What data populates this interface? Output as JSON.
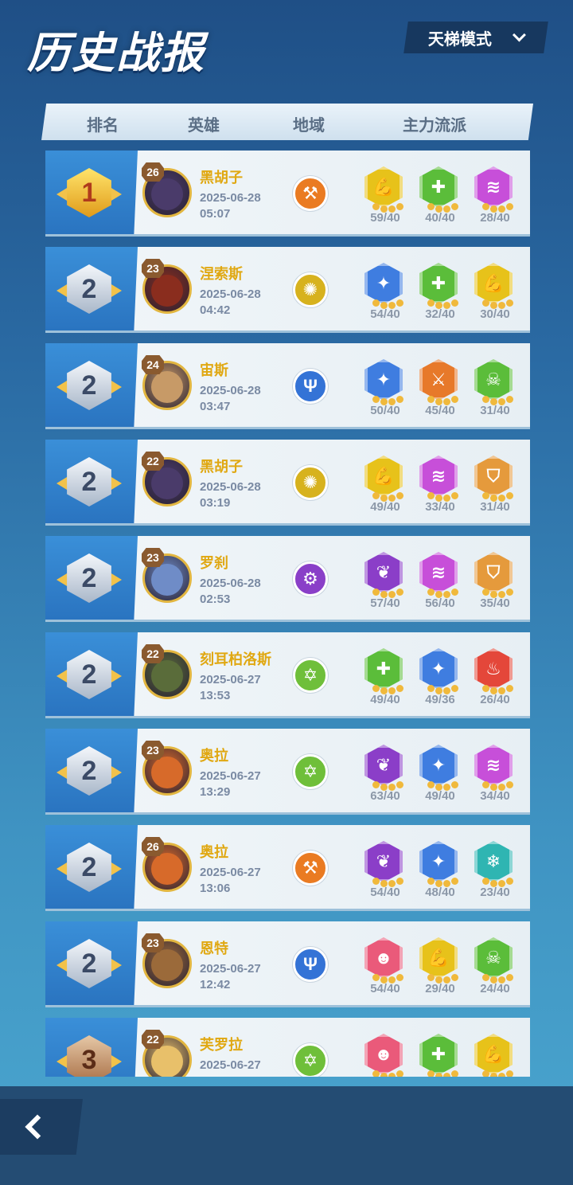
{
  "page_title": "历史战报",
  "mode_selector": {
    "label": "天梯模式"
  },
  "columns": {
    "rank": "排名",
    "hero": "英雄",
    "region": "地域",
    "build": "主力流派"
  },
  "colors": {
    "trait_yellow": "#e7c21a",
    "trait_green": "#5bbd3a",
    "trait_purple": "#c74fd9",
    "trait_blue": "#3f7de0",
    "trait_orange": "#e7792a",
    "trait_teal": "#2fb5b2",
    "trait_pink": "#ea5a7a",
    "trait_red": "#e4473a",
    "trait_violet": "#8b3ec8",
    "shield_orange": "#e59a3c"
  },
  "rows": [
    {
      "rank": "1",
      "level": "26",
      "hero": "黑胡子",
      "date": "2025-06-28",
      "time": "05:07",
      "region_icon": "axe-icon",
      "traits": [
        {
          "icon": "muscle-icon",
          "value": "59/40"
        },
        {
          "icon": "plus-icon",
          "value": "40/40"
        },
        {
          "icon": "claw-icon",
          "value": "28/40"
        }
      ]
    },
    {
      "rank": "2",
      "level": "23",
      "hero": "涅索斯",
      "date": "2025-06-28",
      "time": "04:42",
      "region_icon": "swirl-icon",
      "traits": [
        {
          "icon": "sparkle-icon",
          "value": "54/40"
        },
        {
          "icon": "plus-icon",
          "value": "32/40"
        },
        {
          "icon": "muscle-icon",
          "value": "30/40"
        }
      ]
    },
    {
      "rank": "2",
      "level": "24",
      "hero": "宙斯",
      "date": "2025-06-28",
      "time": "03:47",
      "region_icon": "trident-icon",
      "traits": [
        {
          "icon": "sparkle-icon",
          "value": "50/40"
        },
        {
          "icon": "sword-icon",
          "value": "45/40"
        },
        {
          "icon": "poison-icon",
          "value": "31/40"
        }
      ]
    },
    {
      "rank": "2",
      "level": "22",
      "hero": "黑胡子",
      "date": "2025-06-28",
      "time": "03:19",
      "region_icon": "swirl-icon",
      "traits": [
        {
          "icon": "muscle-icon",
          "value": "49/40"
        },
        {
          "icon": "claw-icon",
          "value": "33/40"
        },
        {
          "icon": "shield-icon",
          "value": "31/40"
        }
      ]
    },
    {
      "rank": "2",
      "level": "23",
      "hero": "罗刹",
      "date": "2025-06-28",
      "time": "02:53",
      "region_icon": "gear-icon",
      "traits": [
        {
          "icon": "leaf-icon",
          "value": "57/40"
        },
        {
          "icon": "claw-icon",
          "value": "56/40"
        },
        {
          "icon": "shield-icon",
          "value": "35/40"
        }
      ]
    },
    {
      "rank": "2",
      "level": "22",
      "hero": "刻耳柏洛斯",
      "date": "2025-06-27",
      "time": "13:53",
      "region_icon": "pentagram-icon",
      "traits": [
        {
          "icon": "plus-icon",
          "value": "49/40"
        },
        {
          "icon": "sparkle-icon",
          "value": "49/36"
        },
        {
          "icon": "flame-icon",
          "value": "26/40"
        }
      ]
    },
    {
      "rank": "2",
      "level": "23",
      "hero": "奥拉",
      "date": "2025-06-27",
      "time": "13:29",
      "region_icon": "pentagram-icon",
      "traits": [
        {
          "icon": "leaf-icon",
          "value": "63/40"
        },
        {
          "icon": "sparkle-icon",
          "value": "49/40"
        },
        {
          "icon": "claw-icon",
          "value": "34/40"
        }
      ]
    },
    {
      "rank": "2",
      "level": "26",
      "hero": "奥拉",
      "date": "2025-06-27",
      "time": "13:06",
      "region_icon": "axe-icon",
      "traits": [
        {
          "icon": "leaf-icon",
          "value": "54/40"
        },
        {
          "icon": "sparkle-icon",
          "value": "48/40"
        },
        {
          "icon": "snowflake-icon",
          "value": "23/40"
        }
      ]
    },
    {
      "rank": "2",
      "level": "23",
      "hero": "恩特",
      "date": "2025-06-27",
      "time": "12:42",
      "region_icon": "trident-icon",
      "traits": [
        {
          "icon": "mask-icon",
          "value": "54/40"
        },
        {
          "icon": "muscle-icon",
          "value": "29/40"
        },
        {
          "icon": "poison-icon",
          "value": "24/40"
        }
      ]
    },
    {
      "rank": "3",
      "level": "22",
      "hero": "芙罗拉",
      "date": "2025-06-27",
      "time": "",
      "region_icon": "pentagram-icon",
      "traits": [
        {
          "icon": "mask-icon",
          "value": ""
        },
        {
          "icon": "plus-icon",
          "value": ""
        },
        {
          "icon": "muscle-icon",
          "value": ""
        }
      ]
    }
  ]
}
